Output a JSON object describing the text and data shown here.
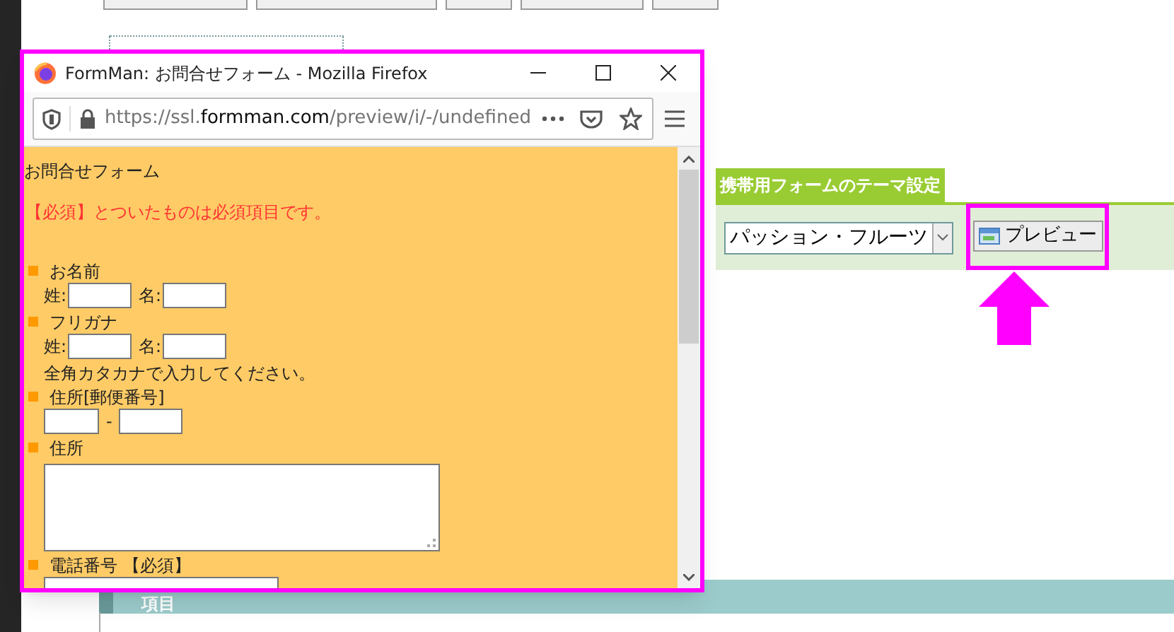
{
  "page": {
    "theme_section": {
      "title": "携帯用フォームのテーマ設定",
      "theme_select": {
        "value": "パッション・フルーツ"
      },
      "preview_button": {
        "label": "プレビュー"
      }
    },
    "table_header": {
      "label": "項目"
    }
  },
  "browser_window": {
    "title": "FormMan: お問合せフォーム - Mozilla Firefox",
    "url": [
      {
        "kind": "dim",
        "text": "https://ssl."
      },
      {
        "kind": "domain",
        "text": "formman.com"
      },
      {
        "kind": "dim",
        "text": "/preview/i/-/undefined"
      }
    ],
    "form": {
      "title": "お問合せフォーム",
      "notice": "【必須】とついたものは必須項目です。",
      "fields": [
        {
          "kind": "name_pair",
          "label": "お名前",
          "first_label": "姓:",
          "second_label": "名:"
        },
        {
          "kind": "name_pair",
          "label": "フリガナ",
          "first_label": "姓:",
          "second_label": "名:",
          "note": "全角カタカナで入力してください。"
        },
        {
          "kind": "postal",
          "label": "住所[郵便番号]",
          "separator": "-"
        },
        {
          "kind": "textarea",
          "label": "住所"
        },
        {
          "kind": "text",
          "label": "電話番号 【必須】"
        }
      ]
    }
  }
}
